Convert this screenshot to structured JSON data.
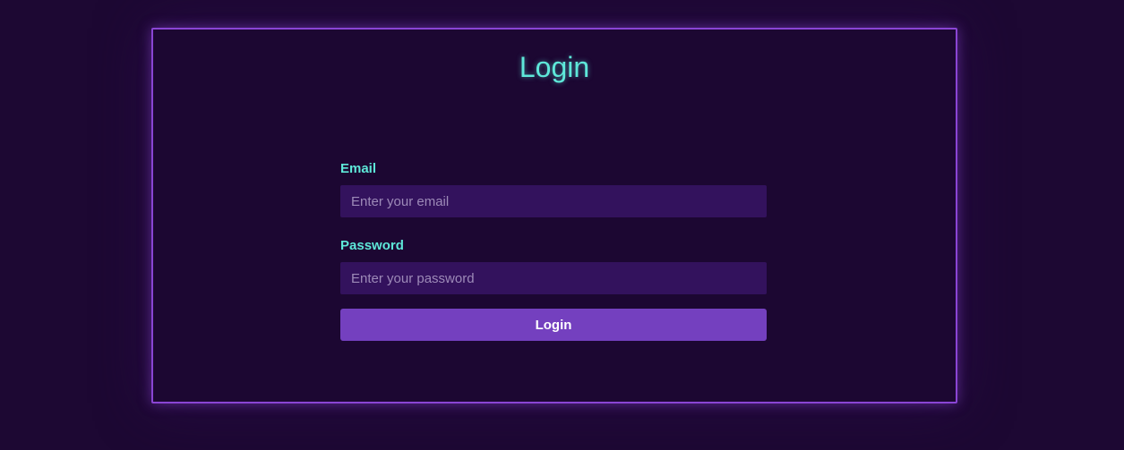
{
  "login": {
    "title": "Login",
    "email": {
      "label": "Email",
      "placeholder": "Enter your email",
      "value": ""
    },
    "password": {
      "label": "Password",
      "placeholder": "Enter your password",
      "value": ""
    },
    "submit_label": "Login"
  },
  "colors": {
    "background": "#1d0833",
    "panel_border": "#8a45d4",
    "accent_text": "#5ee8d9",
    "input_background": "#33125d",
    "button_background": "#7440bf"
  }
}
